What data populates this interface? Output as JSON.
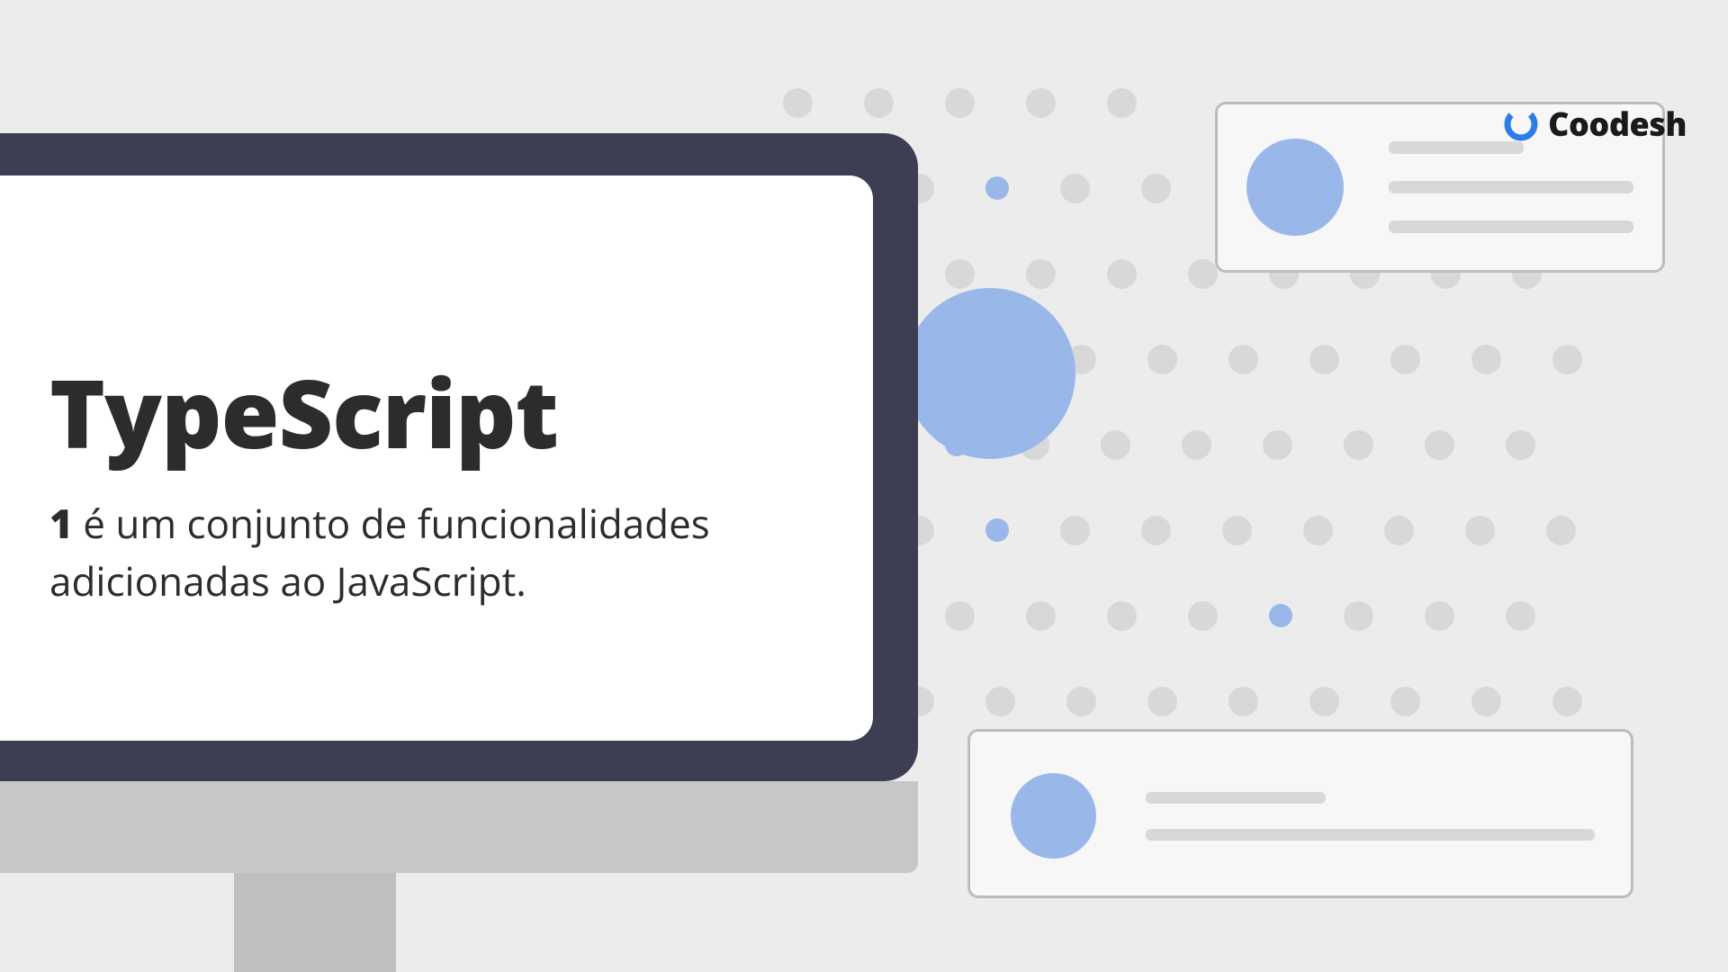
{
  "brand": {
    "name": "Coodesh"
  },
  "content": {
    "title": "TypeScript",
    "definition_number": "1",
    "definition_text": " é um conjunto de funcionalidades adicionadas ao JavaScript."
  },
  "dot_grid": {
    "rows": 8,
    "blue_positions": [
      "r1c3",
      "r3c2",
      "r4c3",
      "r5c6"
    ]
  }
}
